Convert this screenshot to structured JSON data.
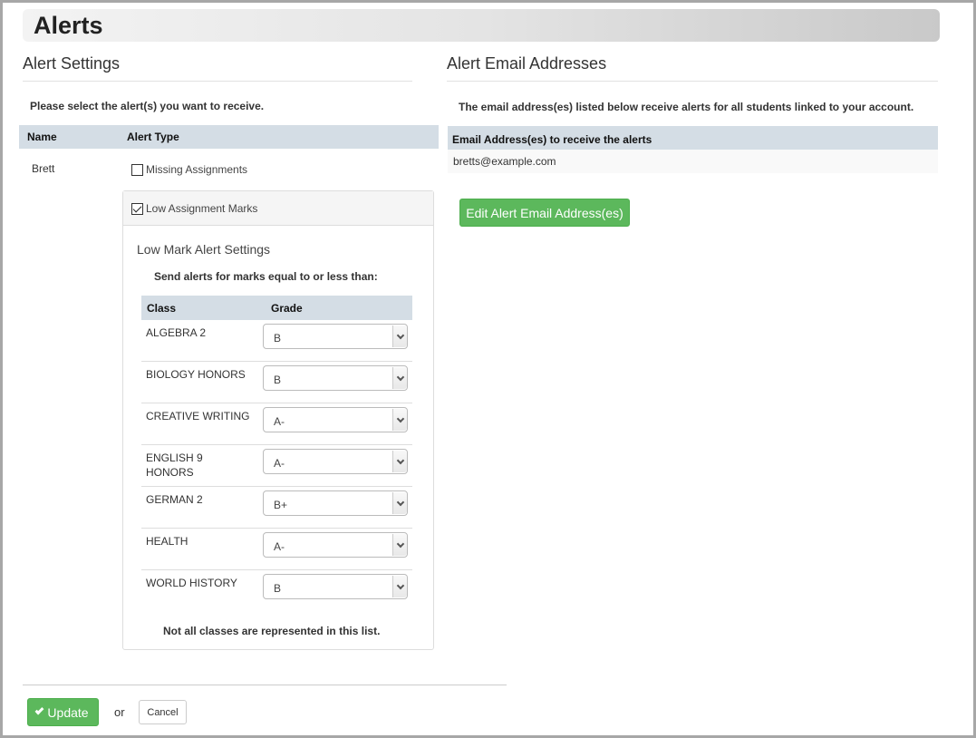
{
  "page": {
    "title": "Alerts"
  },
  "settings": {
    "heading": "Alert Settings",
    "instruction": "Please select the alert(s) you want to receive.",
    "columns": {
      "name": "Name",
      "alert_type": "Alert Type"
    },
    "student": "Brett",
    "alerts": [
      {
        "label": "Missing Assignments",
        "checked": false
      },
      {
        "label": "Low Assignment Marks",
        "checked": true
      }
    ],
    "low_mark": {
      "title": "Low Mark Alert Settings",
      "subtitle": "Send alerts for marks equal to or less than:",
      "columns": {
        "class": "Class",
        "grade": "Grade"
      },
      "rows": [
        {
          "class": "ALGEBRA 2",
          "grade": "B"
        },
        {
          "class": "BIOLOGY HONORS",
          "grade": "B"
        },
        {
          "class": "CREATIVE WRITING",
          "grade": "A-"
        },
        {
          "class": "ENGLISH 9 HONORS",
          "grade": "A-"
        },
        {
          "class": "GERMAN 2",
          "grade": "B+"
        },
        {
          "class": "HEALTH",
          "grade": "A-"
        },
        {
          "class": "WORLD HISTORY",
          "grade": "B"
        }
      ],
      "footnote": "Not all classes are represented in this list."
    }
  },
  "email": {
    "heading": "Alert Email Addresses",
    "instruction": "The email address(es) listed below receive alerts for all students linked to your account.",
    "column": "Email Address(es) to receive the alerts",
    "addresses": [
      "bretts@example.com"
    ],
    "edit_label": "Edit Alert Email Address(es)"
  },
  "footer": {
    "update_label": "Update",
    "or_label": "or",
    "cancel_label": "Cancel"
  },
  "colors": {
    "accent_green": "#5cb85c",
    "table_header": "#d4dde5"
  }
}
